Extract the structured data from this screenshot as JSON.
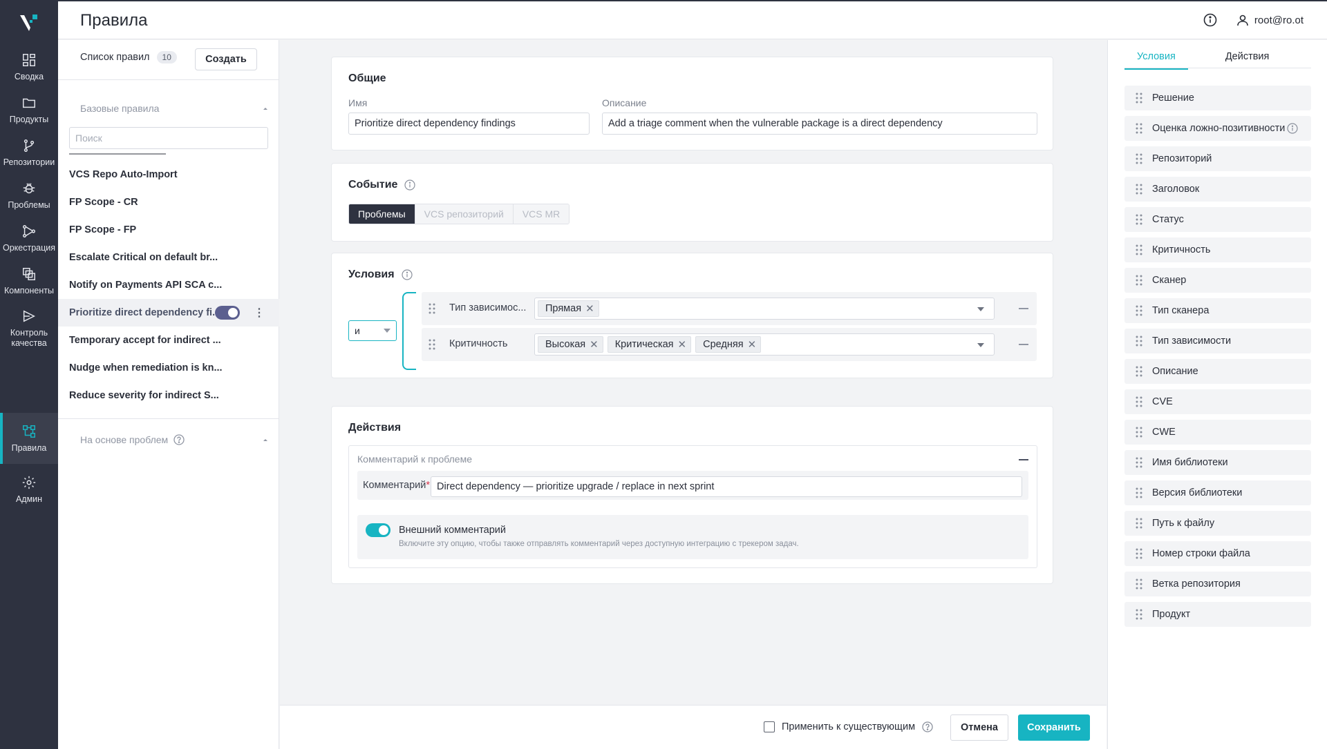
{
  "header": {
    "title": "Правила",
    "user": "root@ro.ot"
  },
  "nav": {
    "items": [
      {
        "label": "Сводка",
        "icon": "dashboard-icon"
      },
      {
        "label": "Продукты",
        "icon": "folder-icon"
      },
      {
        "label": "Репозитории",
        "icon": "git-branch-icon"
      },
      {
        "label": "Проблемы",
        "icon": "bug-icon"
      },
      {
        "label": "Оркестрация",
        "icon": "orchestration-icon"
      },
      {
        "label": "Компоненты",
        "icon": "components-icon"
      },
      {
        "label": "Контроль качества",
        "icon": "quality-gate-icon"
      },
      {
        "label": "Правила",
        "icon": "rules-icon",
        "active": true
      },
      {
        "label": "Админ",
        "icon": "gear-icon"
      }
    ]
  },
  "rules_panel": {
    "list_label": "Список правил",
    "count": "10",
    "create_label": "Создать",
    "base_group": "Базовые правила",
    "search_placeholder": "Поиск",
    "rules": [
      "VCS Repo Auto-Import",
      "FP Scope - CR",
      "FP Scope - FP",
      "Escalate Critical on default br...",
      "Notify on Payments API SCA c...",
      "Prioritize direct dependency fi...",
      "Temporary accept for indirect ...",
      "Nudge when remediation is kn...",
      "Reduce severity for indirect S..."
    ],
    "active_rule_index": 5,
    "issue_group": "На основе проблем"
  },
  "general": {
    "title": "Общие",
    "name_label": "Имя",
    "name_value": "Prioritize direct dependency findings",
    "desc_label": "Описание",
    "desc_value": "Add a triage comment when the vulnerable package is a direct dependency"
  },
  "event": {
    "title": "Событие",
    "options": [
      "Проблемы",
      "VCS репозиторий",
      "VCS MR"
    ],
    "selected": "Проблемы"
  },
  "conditions": {
    "title": "Условия",
    "operator": "и",
    "rows": [
      {
        "field": "Тип зависимос...",
        "values": [
          "Прямая"
        ]
      },
      {
        "field": "Критичность",
        "values": [
          "Высокая",
          "Критическая",
          "Средняя"
        ]
      }
    ]
  },
  "actions": {
    "title": "Действия",
    "action_title": "Комментарий к проблеме",
    "comment_label": "Комментарий",
    "comment_required_mark": "*",
    "comment_value": "Direct dependency — prioritize upgrade / replace in next sprint",
    "external_title": "Внешний комментарий",
    "external_desc": "Включите эту опцию, чтобы также отправлять комментарий через доступную интеграцию с трекером задач.",
    "external_enabled": true
  },
  "footer": {
    "apply_label": "Применить к существующим",
    "cancel_label": "Отмена",
    "save_label": "Сохранить"
  },
  "side": {
    "tabs": [
      "Условия",
      "Действия"
    ],
    "active_tab": "Условия",
    "fields": [
      "Решение",
      "Оценка ложно-позитивности",
      "Репозиторий",
      "Заголовок",
      "Статус",
      "Критичность",
      "Сканер",
      "Тип сканера",
      "Тип зависимости",
      "Описание",
      "CVE",
      "CWE",
      "Имя библиотеки",
      "Версия библиотеки",
      "Путь к файлу",
      "Номер строки файла",
      "Ветка репозитория",
      "Продукт"
    ]
  },
  "colors": {
    "accent": "#17b4c2",
    "nav_bg": "#2e3240",
    "toggle_dark": "#5b5f8f",
    "required": "#d8334a"
  }
}
